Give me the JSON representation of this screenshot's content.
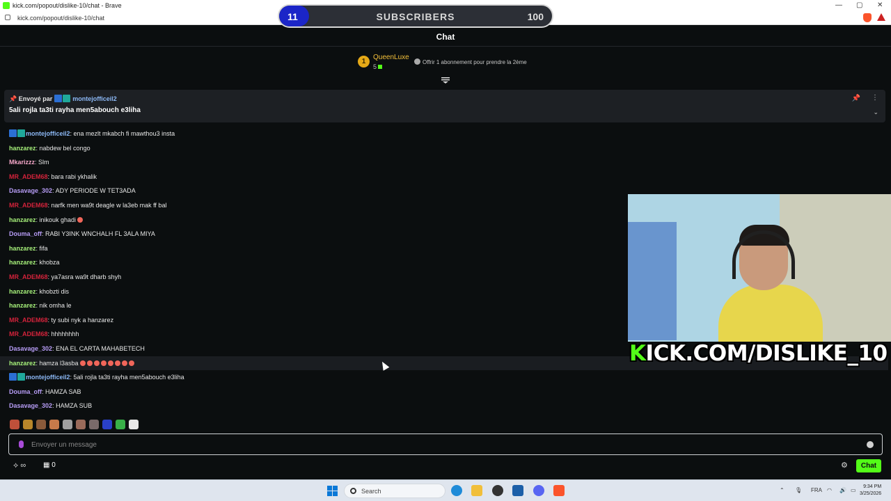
{
  "browser": {
    "window_title": "kick.com/popout/dislike-10/chat - Brave",
    "url": "kick.com/popout/dislike-10/chat"
  },
  "sub_goal": {
    "current": "11",
    "label": "SUBSCRIBERS",
    "target": "100",
    "progress": 0.11
  },
  "chat": {
    "title": "Chat"
  },
  "leaderboard": {
    "rank": "1",
    "name": "QueenLuxe",
    "count": "5",
    "gift_text": "Offrir 1 abonnement pour prendre la 2ème"
  },
  "pinned": {
    "sent_by": "Envoyé par",
    "user": "montejofficeil2",
    "message": "5ali rojla ta3ti rayha men5abouch e3liha"
  },
  "messages": [
    {
      "user": "montejofficeil2",
      "text": ": ena mezlt mkabch fi mawthou3 insta",
      "color": "#8cb8f5",
      "badges": [
        "mod",
        "vip"
      ]
    },
    {
      "user": "hanzarez",
      "text": ": nabdew bel congo",
      "color": "#a6f07a"
    },
    {
      "user": "Mkarizzz",
      "text": ": Slm",
      "color": "#f4a6c8"
    },
    {
      "user": "MR_ADEM68",
      "text": ": bara rabi ykhalik",
      "color": "#d4233b"
    },
    {
      "user": "Dasavage_302",
      "text": ": ADY PERIODE W TET3ADA",
      "color": "#b69cf5"
    },
    {
      "user": "MR_ADEM68",
      "text": ": narfk men wa9t deagle w la3eb mak ff bal",
      "color": "#d4233b"
    },
    {
      "user": "hanzarez",
      "text": ": inikouk ghadi",
      "color": "#a6f07a",
      "emojis": 1
    },
    {
      "user": "Douma_off",
      "text": ": RABI Y3INK WNCHALH FL 3ALA MIYA",
      "color": "#b69cf5"
    },
    {
      "user": "hanzarez",
      "text": ": fifa",
      "color": "#a6f07a"
    },
    {
      "user": "hanzarez",
      "text": ": khobza",
      "color": "#a6f07a"
    },
    {
      "user": "MR_ADEM68",
      "text": ": ya7asra wa9t dharb shyh",
      "color": "#d4233b"
    },
    {
      "user": "hanzarez",
      "text": ": khobzti dis",
      "color": "#a6f07a"
    },
    {
      "user": "hanzarez",
      "text": ": nik omha le",
      "color": "#a6f07a"
    },
    {
      "user": "MR_ADEM68",
      "text": ": ty subi nyk a hanzarez",
      "color": "#d4233b"
    },
    {
      "user": "MR_ADEM68",
      "text": ": hhhhhhhh",
      "color": "#d4233b"
    },
    {
      "user": "Dasavage_302",
      "text": ": ENA EL CARTA MAHABETECH",
      "color": "#b69cf5"
    },
    {
      "user": "hanzarez",
      "text": ": hamza l3asba",
      "color": "#a6f07a",
      "emojis": 8,
      "highlight": true
    },
    {
      "user": "montejofficeil2",
      "text": ": 5ali rojla ta3ti rayha men5abouch e3liha",
      "color": "#8cb8f5",
      "badges": [
        "mod",
        "vip"
      ]
    },
    {
      "user": "Douma_off",
      "text": ": HAMZA SAB",
      "color": "#b69cf5"
    },
    {
      "user": "Dasavage_302",
      "text": ": HAMZA SUB",
      "color": "#b69cf5"
    }
  ],
  "stream_overlay": {
    "brand_k": "K",
    "brand_rest": "ICK.COM/DISLIKE_10"
  },
  "emotes": [
    "#c0503a",
    "#b8862a",
    "#8a5a3a",
    "#c77a4a",
    "#a0a0a0",
    "#9a6a5a",
    "#7a6a6a",
    "#2a40c8",
    "#38b048",
    "#e8e8e8"
  ],
  "input": {
    "placeholder": "Envoyer un message"
  },
  "footer": {
    "points": "0",
    "chat_button": "Chat"
  },
  "taskbar": {
    "search": "Search",
    "lang": "FRA",
    "time": "9:34 PM",
    "date": "3/25/2026"
  },
  "colors": {
    "accent": "#53fc18",
    "bg": "#0b0e0f"
  }
}
